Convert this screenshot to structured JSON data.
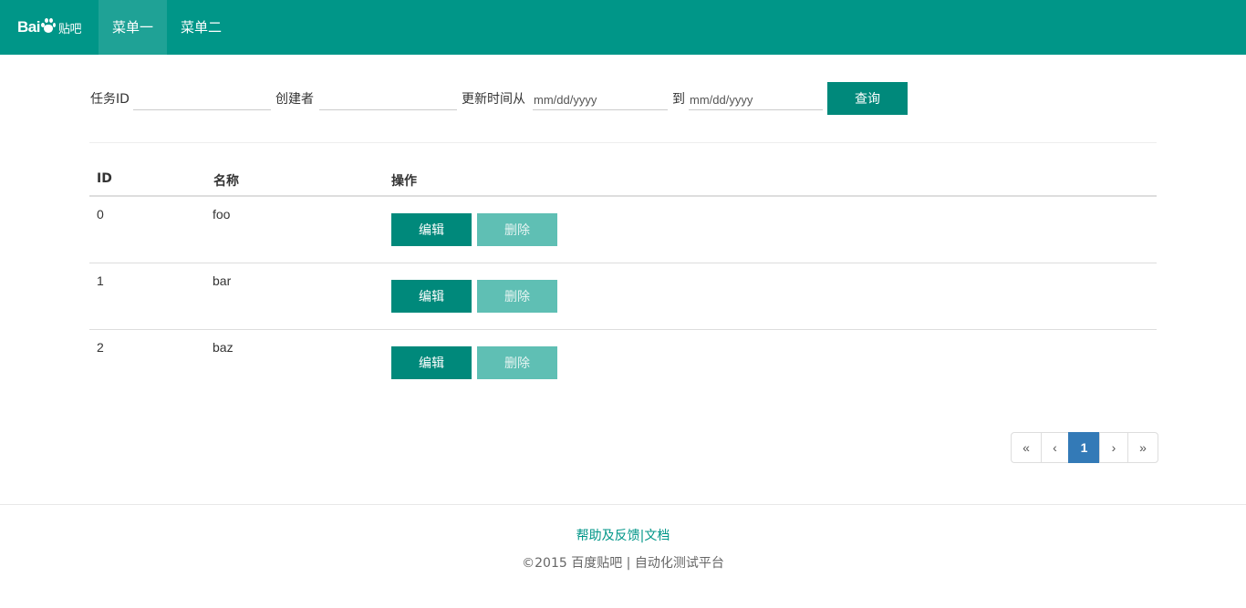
{
  "navbar": {
    "brand": {
      "latin": "Bai",
      "latin2": "",
      "chinese": "贴吧"
    },
    "menus": [
      {
        "label": "菜单一",
        "active": true
      },
      {
        "label": "菜单二",
        "active": false
      }
    ],
    "accent_color": "#009688"
  },
  "search": {
    "task_id_label": "任务ID",
    "task_id_value": "",
    "creator_label": "创建者",
    "creator_value": "",
    "update_from_label": "更新时间从",
    "update_from_placeholder": "mm/dd/yyyy",
    "to_label": "到",
    "update_to_placeholder": "mm/dd/yyyy",
    "query_button": "查询"
  },
  "table": {
    "columns": [
      "ID",
      "名称",
      "操作"
    ],
    "rows": [
      {
        "id": "0",
        "name": "foo",
        "edit": "编辑",
        "delete": "删除"
      },
      {
        "id": "1",
        "name": "bar",
        "edit": "编辑",
        "delete": "删除"
      },
      {
        "id": "2",
        "name": "baz",
        "edit": "编辑",
        "delete": "删除"
      }
    ],
    "primary_button_color": "#00897b",
    "disabled_button_color": "#5fbfb4"
  },
  "pagination": {
    "first": "«",
    "prev": "‹",
    "current": "1",
    "next": "›",
    "last": "»",
    "active_color": "#337ab7"
  },
  "footer": {
    "help_link": "帮助及反馈",
    "separator": "|",
    "docs_link": "文档",
    "copyright": "©2015 百度贴吧 | 自动化测试平台"
  }
}
